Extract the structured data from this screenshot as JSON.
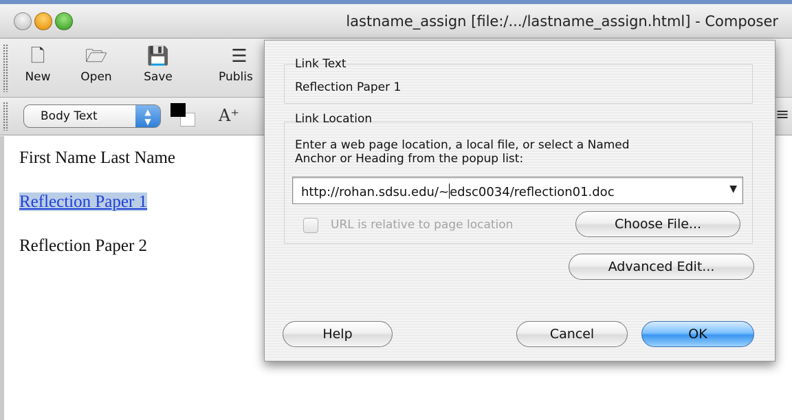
{
  "window": {
    "title": "lastname_assign [file:/.../lastname_assign.html] - Composer"
  },
  "toolbar": {
    "buttons": [
      {
        "label": "New",
        "icon": "new-page-icon"
      },
      {
        "label": "Open",
        "icon": "open-folder-icon"
      },
      {
        "label": "Save",
        "icon": "save-disk-icon"
      },
      {
        "label": "Publis",
        "icon": "publish-icon"
      }
    ],
    "paragraph_format": "Body Text"
  },
  "document": {
    "lines": [
      {
        "text": "First Name   Last Name",
        "is_link": false
      },
      {
        "text": "Reflection Paper 1",
        "is_link": true
      },
      {
        "text": "Reflection Paper 2",
        "is_link": false
      }
    ]
  },
  "dialog": {
    "link_text_group": "Link Text",
    "link_text_value": "Reflection Paper 1",
    "link_location_group": "Link Location",
    "instructions_line1": "Enter a web page location, a local file, or select a Named",
    "instructions_line2": "Anchor or Heading from the popup list:",
    "url_before_caret": "http://rohan.sdsu.edu/~",
    "url_after_caret": "edsc0034/reflection01.doc",
    "relative_checkbox_label": "URL is relative to page location",
    "relative_checked": false,
    "choose_file_label": "Choose File...",
    "advanced_edit_label": "Advanced Edit...",
    "help_label": "Help",
    "cancel_label": "Cancel",
    "ok_label": "OK"
  },
  "colors": {
    "link": "#1f3fd9",
    "link_highlight": "#b9cde6",
    "default_button": "#3b96f0"
  }
}
